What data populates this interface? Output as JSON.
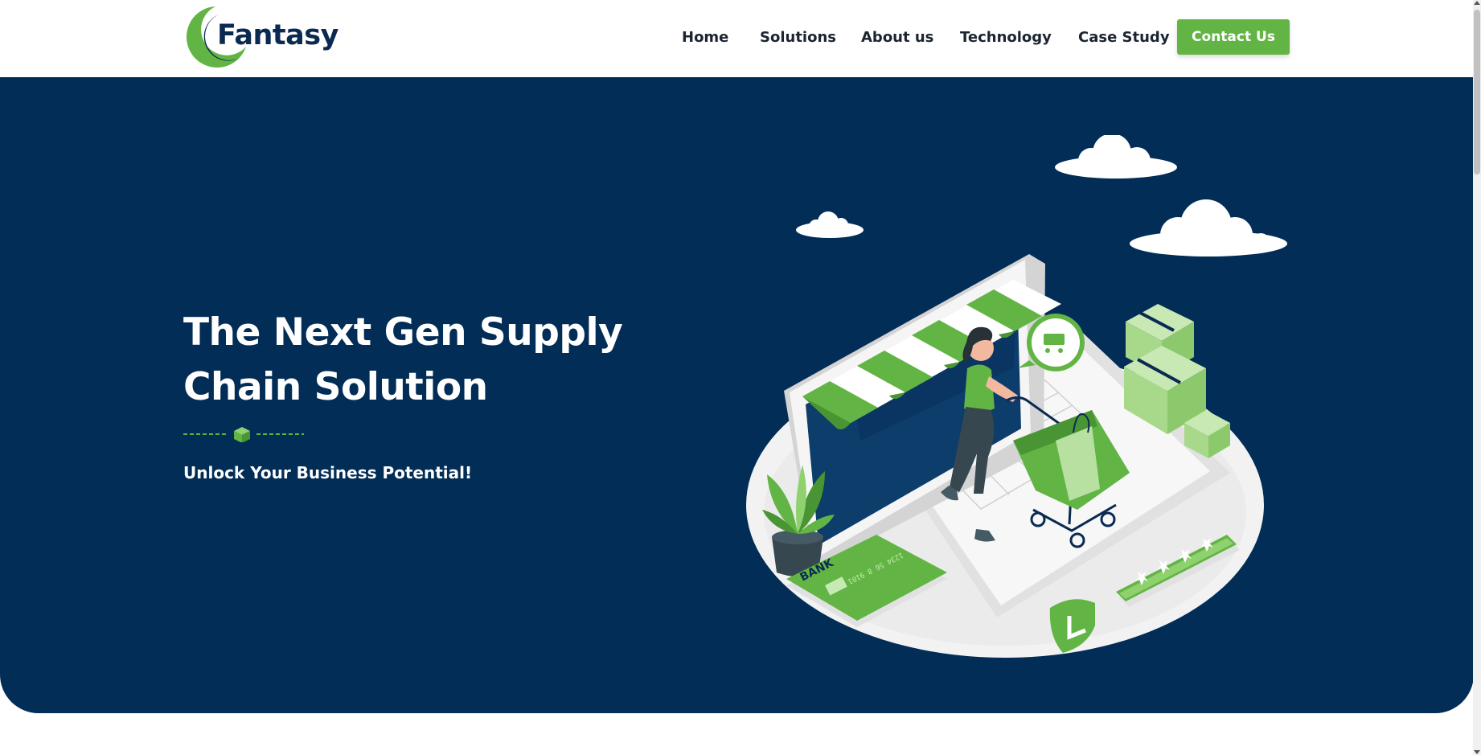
{
  "brand": {
    "name": "Fantasy",
    "logo_icon": "crescent-logo-icon",
    "colors": {
      "navy": "#0b2a52",
      "green": "#62b544"
    }
  },
  "nav": {
    "items": [
      {
        "label": "Home"
      },
      {
        "label": "Solutions"
      },
      {
        "label": "About us"
      },
      {
        "label": "Technology"
      },
      {
        "label": "Case Study"
      }
    ],
    "cta_label": "Contact Us"
  },
  "hero": {
    "title_line1": "The Next Gen Supply",
    "title_line2": "Chain Solution",
    "divider_icon": "cube-icon",
    "subtitle": "Unlock Your Business Potential!",
    "background": "#022d56",
    "illustration": {
      "card_text": "BANK",
      "card_number": "1234 56 8 9101"
    }
  }
}
